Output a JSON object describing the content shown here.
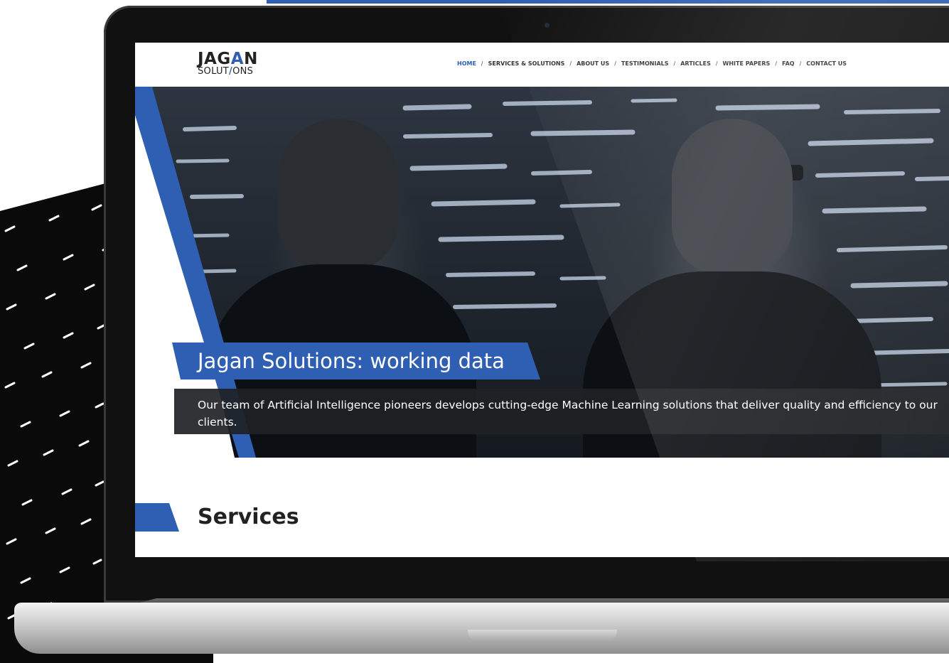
{
  "logo": {
    "top_pre": "JAG",
    "top_accent": "A",
    "top_post": "N",
    "bottom_pre": "SOLUT",
    "bottom_accent": "/",
    "bottom_post": "ONS"
  },
  "nav": {
    "items": [
      "HOME",
      "SERVICES & SOLUTIONS",
      "ABOUT US",
      "TESTIMONIALS",
      "ARTICLES",
      "WHITE PAPERS",
      "FAQ",
      "CONTACT US"
    ],
    "separator": "/",
    "active": "HOME"
  },
  "hero": {
    "title_strong": "Jagan Solutions:",
    "title_rest": " working data",
    "description": "Our team of Artificial Intelligence pioneers develops cutting-edge Machine Learning solutions that deliver quality and efficiency to our clients."
  },
  "services": {
    "heading": "Services"
  },
  "colors": {
    "accent": "#2f5fb3",
    "dark": "#222222"
  }
}
